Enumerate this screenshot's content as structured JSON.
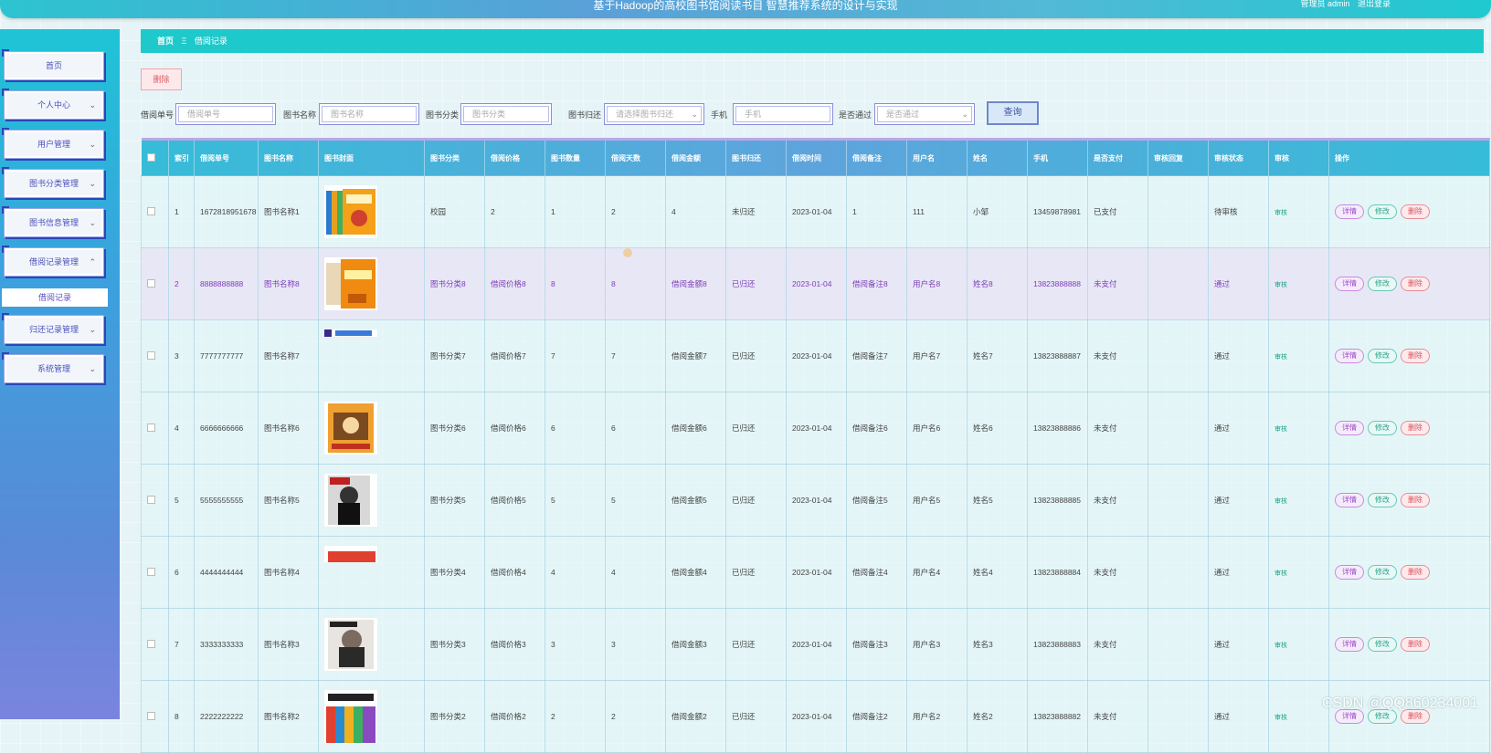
{
  "header": {
    "title": "基于Hadoop的高校图书馆阅读书目 智慧推荐系统的设计与实现",
    "role": "管理员 admin",
    "logout": "退出登录"
  },
  "sidebar": {
    "items": [
      {
        "label": "首页",
        "chev": ""
      },
      {
        "label": "个人中心",
        "chev": "⌄"
      },
      {
        "label": "用户管理",
        "chev": "⌄"
      },
      {
        "label": "图书分类管理",
        "chev": "⌄"
      },
      {
        "label": "图书信息管理",
        "chev": "⌄"
      },
      {
        "label": "借阅记录管理",
        "chev": "⌃"
      },
      {
        "label": "归还记录管理",
        "chev": "⌄"
      },
      {
        "label": "系统管理",
        "chev": "⌄"
      }
    ],
    "submenu": "借阅记录"
  },
  "breadcrumb": {
    "home": "首页",
    "sep": "Ξ",
    "current": "借阅记录"
  },
  "toolbar": {
    "delete_label": "删除",
    "query_label": "查询"
  },
  "search": {
    "borrow_no": {
      "label": "借阅单号",
      "placeholder": "借阅单号"
    },
    "book_name": {
      "label": "图书名称",
      "placeholder": "图书名称"
    },
    "category": {
      "label": "图书分类",
      "placeholder": "图书分类"
    },
    "return_status": {
      "label": "图书归还",
      "placeholder": "请选择图书归还"
    },
    "phone": {
      "label": "手机",
      "placeholder": "手机"
    },
    "approved": {
      "label": "是否通过",
      "placeholder": "是否通过"
    }
  },
  "table": {
    "headers": [
      "",
      "索引",
      "借阅单号",
      "图书名称",
      "图书封面",
      "图书分类",
      "借阅价格",
      "图书数量",
      "借阅天数",
      "借阅金额",
      "图书归还",
      "借阅时间",
      "借阅备注",
      "用户名",
      "姓名",
      "手机",
      "是否支付",
      "审核回复",
      "审核状态",
      "审核",
      "操作"
    ],
    "actions": {
      "detail": "详情",
      "edit": "修改",
      "delete": "删除",
      "audit": "审核"
    },
    "rows": [
      {
        "idx": "1",
        "no": "1672818951678",
        "name": "图书名称1",
        "category": "校园",
        "price": "2",
        "qty": "1",
        "days": "2",
        "amount": "4",
        "returned": "未归还",
        "time": "2023-01-04",
        "note": "1",
        "user": "111",
        "realname": "小邹",
        "phone": "13459878981",
        "paid": "已支付",
        "reply": "",
        "status": "待审核",
        "cover": "orange-books"
      },
      {
        "idx": "2",
        "no": "8888888888",
        "name": "图书名称8",
        "category": "图书分类8",
        "price": "借阅价格8",
        "qty": "8",
        "days": "8",
        "amount": "借阅金额8",
        "returned": "已归还",
        "time": "2023-01-04",
        "note": "借阅备注8",
        "user": "用户名8",
        "realname": "姓名8",
        "phone": "13823888888",
        "paid": "未支付",
        "reply": "",
        "status": "通过",
        "cover": "orange-cover"
      },
      {
        "idx": "3",
        "no": "7777777777",
        "name": "图书名称7",
        "category": "图书分类7",
        "price": "借阅价格7",
        "qty": "7",
        "days": "7",
        "amount": "借阅金额7",
        "returned": "已归还",
        "time": "2023-01-04",
        "note": "借阅备注7",
        "user": "用户名7",
        "realname": "姓名7",
        "phone": "13823888887",
        "paid": "未支付",
        "reply": "",
        "status": "通过",
        "cover": "strip"
      },
      {
        "idx": "4",
        "no": "6666666666",
        "name": "图书名称6",
        "category": "图书分类6",
        "price": "借阅价格6",
        "qty": "6",
        "days": "6",
        "amount": "借阅金额6",
        "returned": "已归还",
        "time": "2023-01-04",
        "note": "借阅备注6",
        "user": "用户名6",
        "realname": "姓名6",
        "phone": "13823888886",
        "paid": "未支付",
        "reply": "",
        "status": "通过",
        "cover": "comic"
      },
      {
        "idx": "5",
        "no": "5555555555",
        "name": "图书名称5",
        "category": "图书分类5",
        "price": "借阅价格5",
        "qty": "5",
        "days": "5",
        "amount": "借阅金额5",
        "returned": "已归还",
        "time": "2023-01-04",
        "note": "借阅备注5",
        "user": "用户名5",
        "realname": "姓名5",
        "phone": "13823888885",
        "paid": "未支付",
        "reply": "",
        "status": "通过",
        "cover": "portrait"
      },
      {
        "idx": "6",
        "no": "4444444444",
        "name": "图书名称4",
        "category": "图书分类4",
        "price": "借阅价格4",
        "qty": "4",
        "days": "4",
        "amount": "借阅金额4",
        "returned": "已归还",
        "time": "2023-01-04",
        "note": "借阅备注4",
        "user": "用户名4",
        "realname": "姓名4",
        "phone": "13823888884",
        "paid": "未支付",
        "reply": "",
        "status": "通过",
        "cover": "red-strip"
      },
      {
        "idx": "7",
        "no": "3333333333",
        "name": "图书名称3",
        "category": "图书分类3",
        "price": "借阅价格3",
        "qty": "3",
        "days": "3",
        "amount": "借阅金额3",
        "returned": "已归还",
        "time": "2023-01-04",
        "note": "借阅备注3",
        "user": "用户名3",
        "realname": "姓名3",
        "phone": "13823888883",
        "paid": "未支付",
        "reply": "",
        "status": "通过",
        "cover": "magazine"
      },
      {
        "idx": "8",
        "no": "2222222222",
        "name": "图书名称2",
        "category": "图书分类2",
        "price": "借阅价格2",
        "qty": "2",
        "days": "2",
        "amount": "借阅金额2",
        "returned": "已归还",
        "time": "2023-01-04",
        "note": "借阅备注2",
        "user": "用户名2",
        "realname": "姓名2",
        "phone": "13823888882",
        "paid": "未支付",
        "reply": "",
        "status": "通过",
        "cover": "colorful"
      }
    ]
  },
  "watermark": "CSDN @QQ860234001"
}
